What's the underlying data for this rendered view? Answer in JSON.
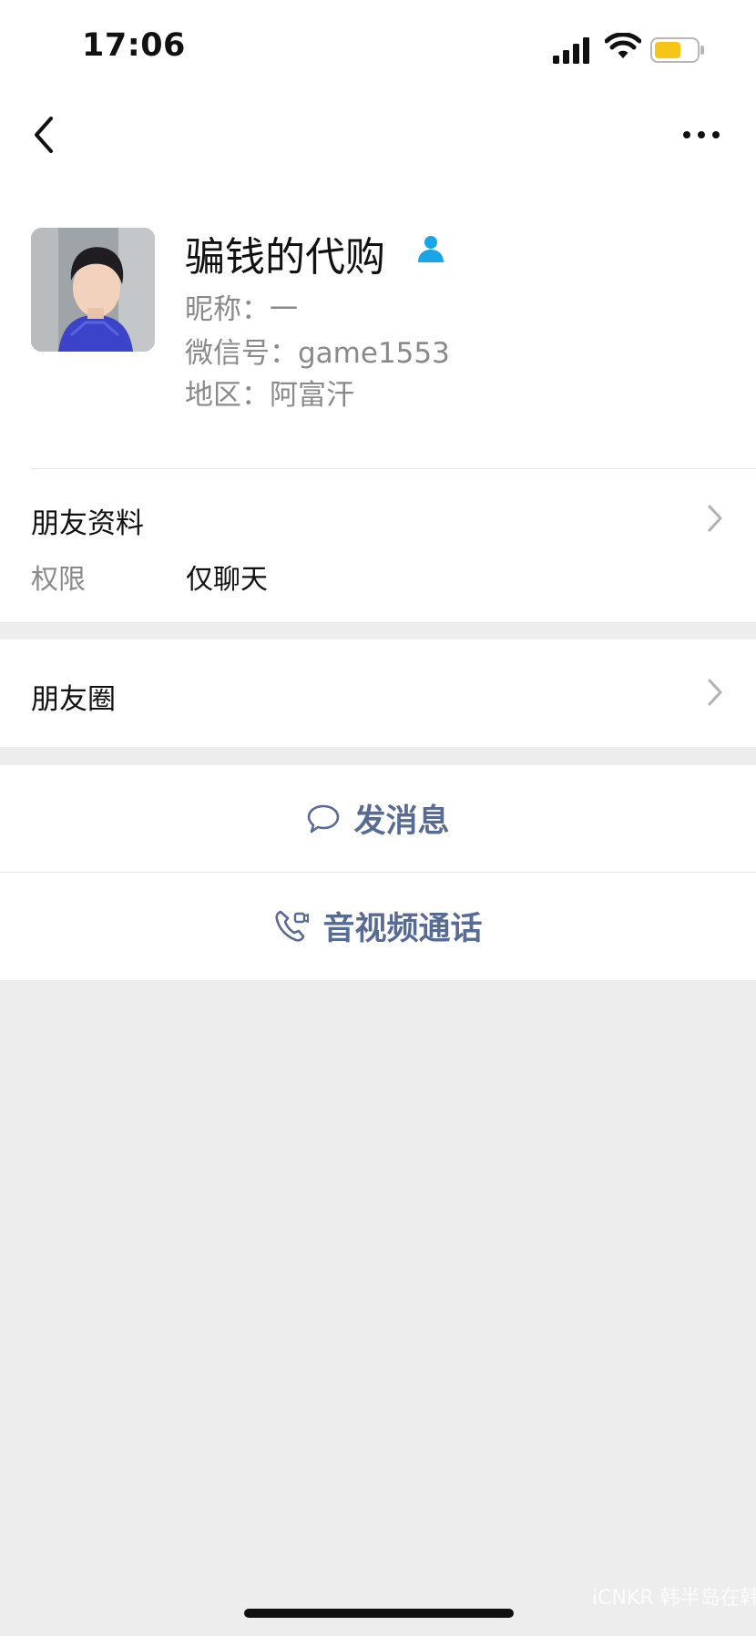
{
  "status_bar": {
    "time": "17:06"
  },
  "nav": {
    "back_icon": "chevron-left-icon",
    "more_icon": "ellipsis-icon"
  },
  "profile": {
    "name": "骗钱的代购",
    "nickname_line": "昵称：一",
    "wechat_id_line": "微信号：game1553",
    "region_line": "地区：阿富汗",
    "verify_icon": "person-icon",
    "verify_color": "#1aa6e6"
  },
  "friend_info": {
    "title": "朋友资料",
    "permission_label": "权限",
    "permission_value": "仅聊天"
  },
  "moments": {
    "title": "朋友圈"
  },
  "actions": {
    "message_label": "发消息",
    "message_icon": "chat-bubble-icon",
    "call_label": "音视频通话",
    "call_icon": "phone-video-icon",
    "accent_color": "#576b95"
  },
  "watermark": {
    "text": "iCNKR 韩半岛在韩国"
  }
}
